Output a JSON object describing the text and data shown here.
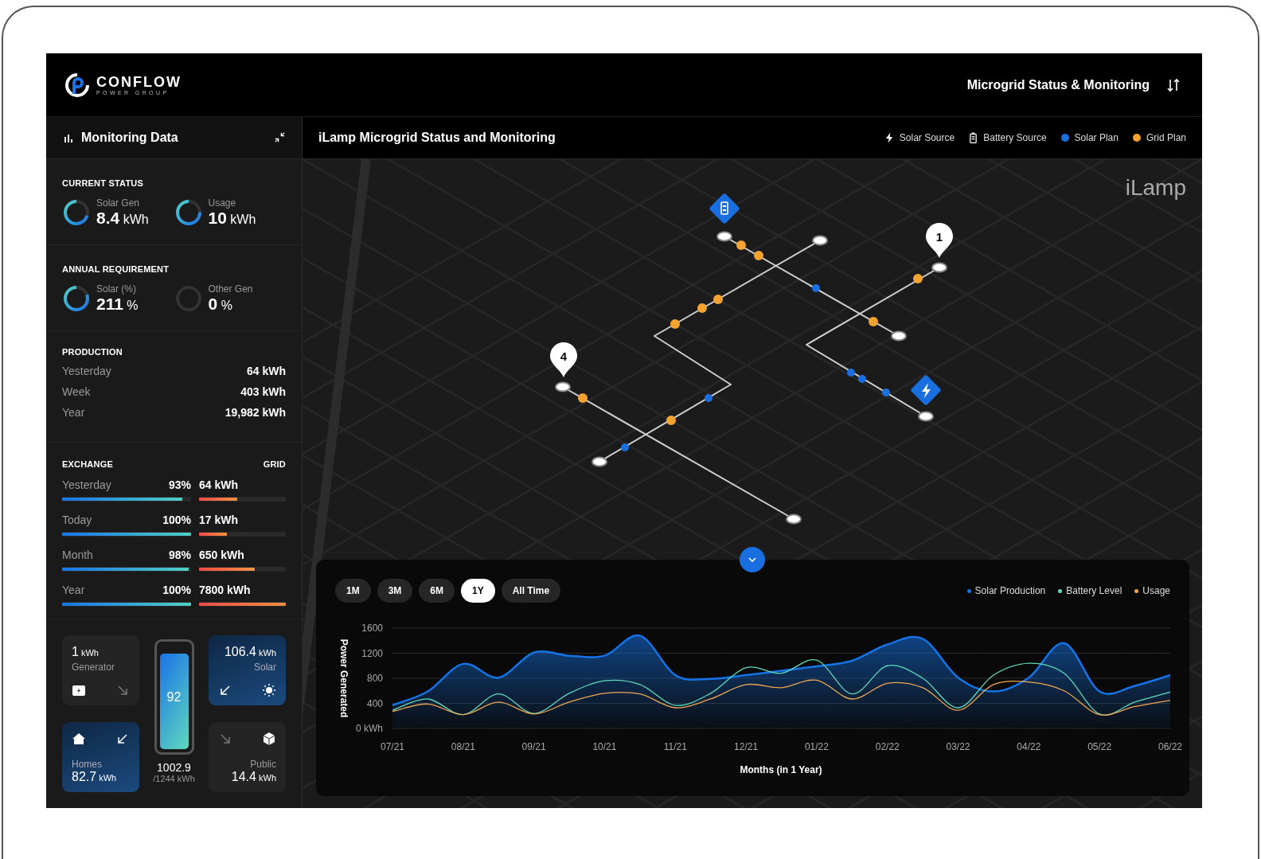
{
  "header": {
    "brand": "CONFLOW",
    "tagline": "POWER GROUP",
    "title": "Microgrid Status & Monitoring"
  },
  "sidebar": {
    "title": "Monitoring Data",
    "gauge_groups": [
      {
        "heading": "CURRENT STATUS",
        "gauges": [
          {
            "label": "Solar Gen",
            "value": "8.4",
            "unit": "kWh",
            "level": 0.7
          },
          {
            "label": "Usage",
            "value": "10",
            "unit": "kWh",
            "level": 0.75
          }
        ]
      },
      {
        "heading": "ANNUAL REQUIREMENT",
        "gauges": [
          {
            "label": "Solar (%)",
            "value": "211",
            "unit": "%",
            "level": 0.8
          },
          {
            "label": "Other Gen",
            "value": "0",
            "unit": "%",
            "level": 0
          }
        ]
      }
    ],
    "production": {
      "heading": "PRODUCTION",
      "rows": [
        {
          "label": "Yesterday",
          "value": "64 kWh"
        },
        {
          "label": "Week",
          "value": "403 kWh"
        },
        {
          "label": "Year",
          "value": "19,982 kWh"
        }
      ]
    },
    "exchange": {
      "heading": "EXCHANGE",
      "grid_heading": "GRID",
      "rows": [
        {
          "label": "Yesterday",
          "percent": "93%",
          "level": 0.93,
          "grid": {
            "value": "64 kWh",
            "level": 0.44
          }
        },
        {
          "label": "Today",
          "percent": "100%",
          "level": 1,
          "grid": {
            "value": "17 kWh",
            "level": 0.32
          }
        },
        {
          "label": "Month",
          "percent": "98%",
          "level": 0.98,
          "grid": {
            "value": "650 kWh",
            "level": 0.64
          }
        },
        {
          "label": "Year",
          "percent": "100%",
          "level": 1,
          "grid": {
            "value": "7800 kWh",
            "level": 1
          }
        }
      ]
    },
    "cards": [
      {
        "kind": "generator",
        "value": "1",
        "unit": "kWh",
        "label": "Generator",
        "highlighted": false
      },
      {
        "kind": "homes",
        "value": "82.7",
        "unit": "kWh",
        "label": "Homes",
        "highlighted": true
      },
      {
        "kind": "solar",
        "value": "106.4",
        "unit": "kWh",
        "label": "Solar",
        "highlighted": true
      },
      {
        "kind": "public",
        "value": "14.4",
        "unit": "kWh",
        "label": "Public",
        "highlighted": false
      }
    ],
    "battery": {
      "charge": "92",
      "level": 0.92,
      "stored": "1002.9",
      "capacity": "/1244 kWh"
    }
  },
  "map": {
    "title": "iLamp Microgrid Status and Monitoring",
    "legend": [
      {
        "label": "Solar Source",
        "kind": "bolt"
      },
      {
        "label": "Battery Source",
        "kind": "battery"
      },
      {
        "label": "Solar Plan",
        "kind": "dot",
        "color": "#1a6fe0"
      },
      {
        "label": "Grid Plan",
        "kind": "dot",
        "color": "#f5a330"
      }
    ],
    "logo": "iLamp",
    "pins": [
      {
        "label": "1"
      },
      {
        "label": "4"
      }
    ]
  },
  "chart_panel": {
    "ranges": [
      {
        "label": "1M",
        "selected": false
      },
      {
        "label": "3M",
        "selected": false
      },
      {
        "label": "6M",
        "selected": false
      },
      {
        "label": "1Y",
        "selected": true
      },
      {
        "label": "All Time",
        "selected": false
      }
    ],
    "chart_data": {
      "type": "line",
      "xlabel": "Months (in 1 Year)",
      "ylabel": "Power Generated",
      "grid": true,
      "categories": [
        "07/21",
        null,
        "08/21",
        null,
        "09/21",
        null,
        "10/21",
        null,
        "11/21",
        null,
        "12/21",
        null,
        "01/22",
        null,
        "02/22",
        null,
        "03/22",
        null,
        "04/22",
        null,
        "05/22",
        null,
        "06/22"
      ],
      "ylim": [
        0,
        1600
      ],
      "yticks": [
        {
          "value": 0,
          "label": "0 kWh"
        },
        400,
        800,
        1200,
        1600
      ],
      "series": [
        {
          "name": "Solar Production",
          "type": "area",
          "color": "#1473e6",
          "values": [
            370,
            590,
            1030,
            810,
            1210,
            1160,
            1160,
            1480,
            850,
            790,
            850,
            920,
            990,
            1080,
            1340,
            1430,
            810,
            590,
            810,
            1360,
            590,
            680,
            850
          ]
        },
        {
          "name": "Battery Level",
          "color": "#5fd9bd",
          "values": [
            290,
            470,
            220,
            550,
            240,
            560,
            760,
            700,
            370,
            560,
            970,
            880,
            1090,
            550,
            1000,
            800,
            330,
            850,
            1040,
            880,
            230,
            420,
            580
          ]
        },
        {
          "name": "Usage",
          "color": "#f0a650",
          "values": [
            270,
            390,
            220,
            420,
            230,
            420,
            560,
            550,
            330,
            470,
            700,
            650,
            770,
            470,
            720,
            650,
            290,
            700,
            740,
            600,
            220,
            350,
            450
          ]
        }
      ]
    }
  }
}
